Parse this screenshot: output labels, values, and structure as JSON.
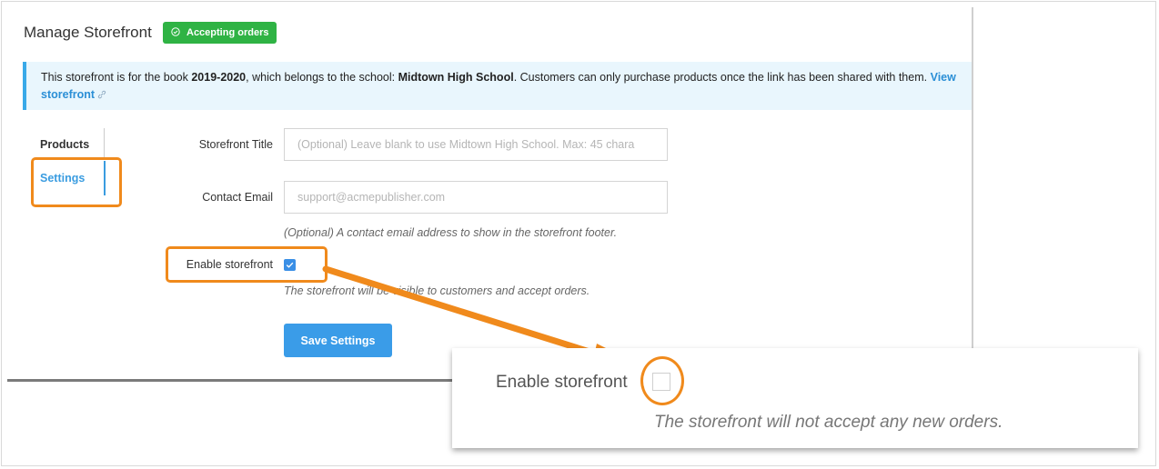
{
  "header": {
    "title": "Manage Storefront",
    "status_badge": "Accepting orders"
  },
  "banner": {
    "text_1": "This storefront is for the book ",
    "book": "2019-2020",
    "text_2": ", which belongs to the school: ",
    "school": "Midtown High School",
    "text_3": ". Customers can only purchase products once the link has been shared with them.",
    "link": "View storefront"
  },
  "tabs": [
    {
      "label": "Products",
      "active": false
    },
    {
      "label": "Settings",
      "active": true
    }
  ],
  "form": {
    "title_label": "Storefront Title",
    "title_placeholder": "(Optional) Leave blank to use Midtown High School. Max: 45 chara",
    "email_label": "Contact Email",
    "email_placeholder": "support@acmepublisher.com",
    "email_help": "(Optional) A contact email address to show in the storefront footer.",
    "enable_label": "Enable storefront",
    "enable_checked": true,
    "enable_help": "The storefront will be visible to customers and accept orders.",
    "save_label": "Save Settings"
  },
  "zoom": {
    "enable_label": "Enable storefront",
    "enable_checked": false,
    "help": "The storefront will not accept any new orders."
  },
  "colors": {
    "accent": "#3a9ce8",
    "success": "#2fb344",
    "highlight": "#f08a1c",
    "banner_bg": "#e9f6fd"
  }
}
